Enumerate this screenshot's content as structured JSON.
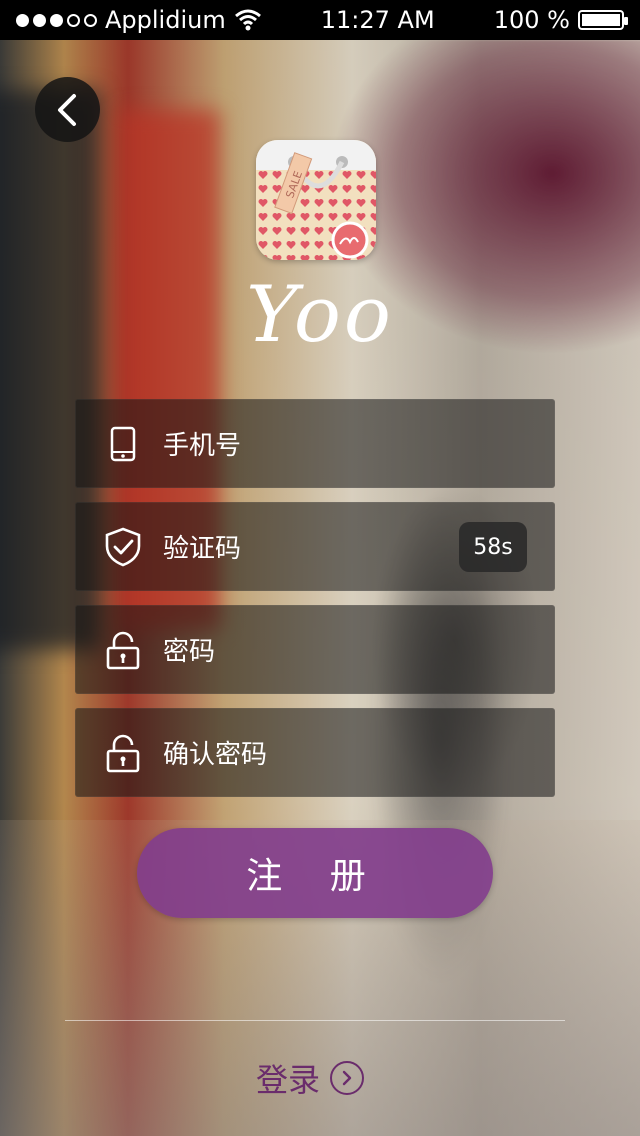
{
  "status_bar": {
    "carrier": "Applidium",
    "time": "11:27 AM",
    "battery": "100 %"
  },
  "app": {
    "logo_text": "Yoo",
    "icon_tag_text": "SALE"
  },
  "form": {
    "phone_placeholder": "手机号",
    "code_placeholder": "验证码",
    "code_timer": "58s",
    "password_placeholder": "密码",
    "confirm_password_placeholder": "确认密码"
  },
  "actions": {
    "register_label": "注 册",
    "login_label": "登录"
  },
  "colors": {
    "accent": "#823E8C",
    "login_text": "#6A2C6C"
  },
  "icons": [
    "phone-icon",
    "shield-check-icon",
    "lock-icon",
    "back-chevron-icon",
    "right-chevron-icon"
  ]
}
